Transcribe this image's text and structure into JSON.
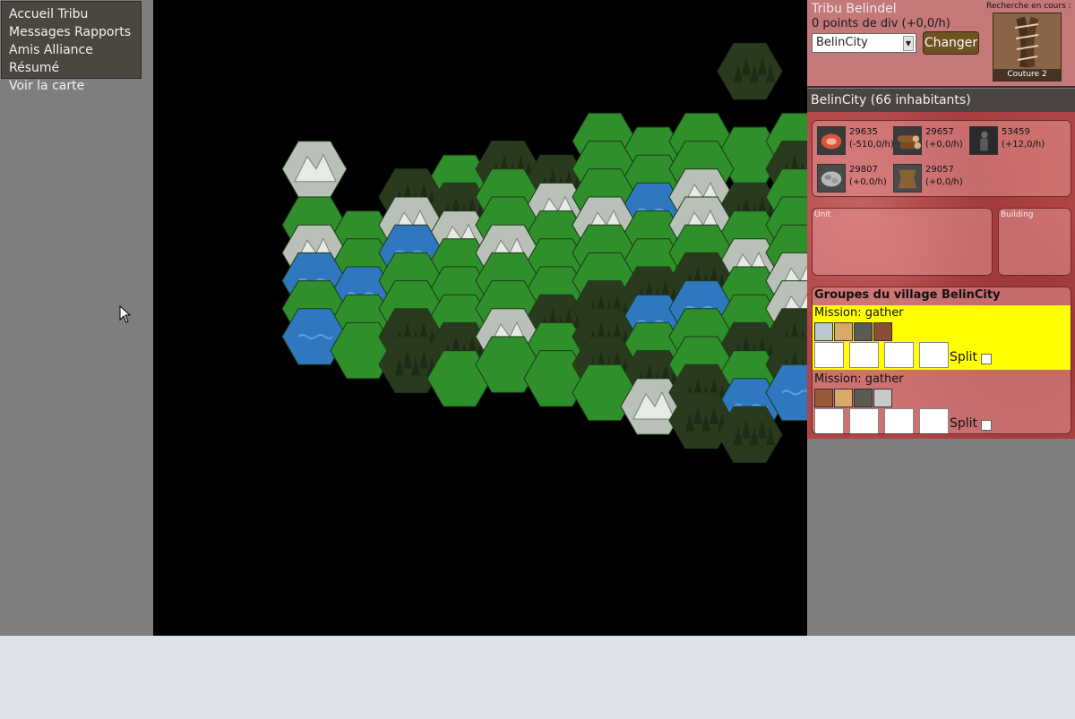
{
  "nav": {
    "links": [
      "Accueil",
      "Tribu",
      "Messages",
      "Rapports",
      "Amis",
      "Alliance",
      "Résumé",
      "Voir la carte"
    ]
  },
  "header": {
    "tribe_name": "Tribu Belindel",
    "points": "0 points de div (+0,0/h)",
    "city_selected": "BelinCity",
    "change_button": "Changer",
    "research_label": "Recherche en cours :",
    "research_name": "Couture 2"
  },
  "city": {
    "title": "BelinCity (66 inhabitants)",
    "resources": [
      {
        "icon": "meat-icon",
        "value": "29635",
        "rate": "(-510,0/h)"
      },
      {
        "icon": "wood-logs-icon",
        "value": "29657",
        "rate": "(+0,0/h)"
      },
      {
        "icon": "population-icon",
        "value": "53459",
        "rate": "(+12,0/h)"
      },
      {
        "icon": "stone-icon",
        "value": "29807",
        "rate": "(+0,0/h)"
      },
      {
        "icon": "leather-hide-icon",
        "value": "29057",
        "rate": "(+0,0/h)"
      }
    ],
    "unit_label": "Unit",
    "building_label": "Building"
  },
  "groups": {
    "title": "Groupes du village BelinCity",
    "missions": [
      {
        "label": "Mission: gather",
        "highlight": true,
        "split_label": "Split"
      },
      {
        "label": "Mission: gather",
        "highlight": false,
        "split_label": "Split"
      }
    ]
  },
  "colors": {
    "grass": "#2f8f2b",
    "forest": "#2a3a1e",
    "water": "#2f78c0",
    "mountain": "#b9c0b8",
    "highlight": "#ffff00",
    "panel_red": "#b04545"
  }
}
